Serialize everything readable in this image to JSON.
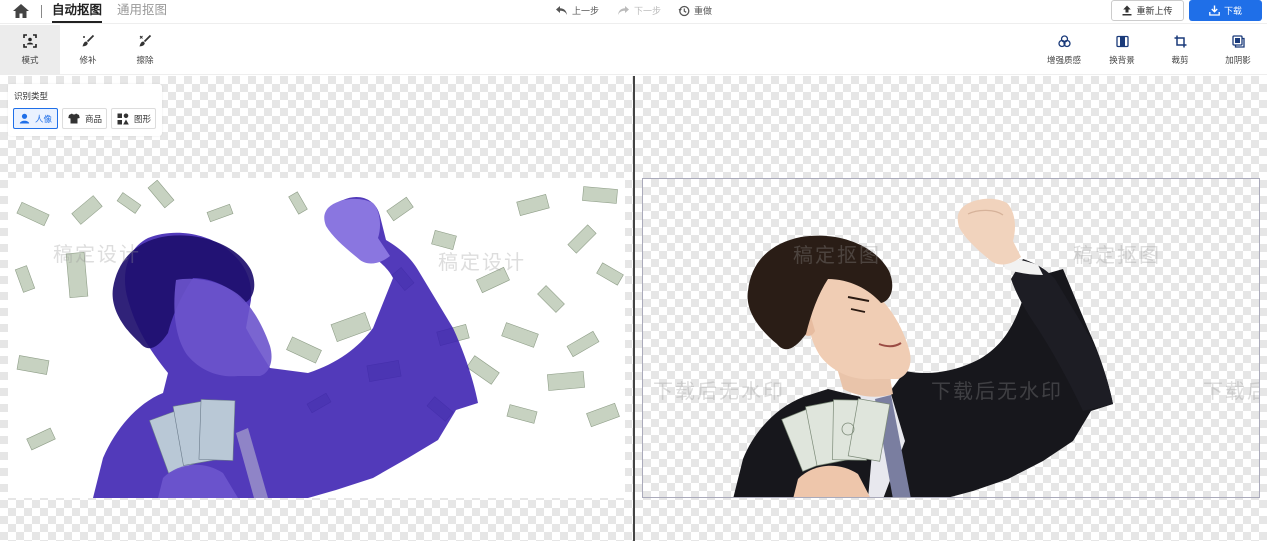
{
  "topbar": {
    "tabs": [
      {
        "label": "自动抠图",
        "active": true
      },
      {
        "label": "通用抠图",
        "active": false
      }
    ],
    "undo_label": "上一步",
    "redo_label": "下一步",
    "reset_label": "重做",
    "reupload_label": "重新上传",
    "download_label": "下载"
  },
  "toolbar": {
    "left_tools": [
      {
        "label": "模式",
        "icon": "mode-icon",
        "active": true
      },
      {
        "label": "修补",
        "icon": "brush-icon"
      },
      {
        "label": "擦除",
        "icon": "eraser-icon"
      }
    ],
    "right_tools": [
      {
        "label": "增强质感",
        "icon": "enhance-icon"
      },
      {
        "label": "换背景",
        "icon": "background-icon"
      },
      {
        "label": "裁剪",
        "icon": "crop-icon"
      },
      {
        "label": "加阴影",
        "icon": "shadow-icon"
      }
    ]
  },
  "recognition_panel": {
    "title": "识别类型",
    "options": [
      {
        "label": "人像",
        "icon": "person-icon",
        "selected": true
      },
      {
        "label": "商品",
        "icon": "shirt-icon",
        "selected": false
      },
      {
        "label": "图形",
        "icon": "shapes-icon",
        "selected": false
      }
    ]
  },
  "watermarks": {
    "left": [
      "稿定设计",
      "稿定设计"
    ],
    "right": [
      "稿定抠图",
      "稿定抠图",
      "下载后无水印",
      "下载后无水印",
      "下载后"
    ]
  },
  "colors": {
    "accent": "#1f6fe8",
    "mask_overlay": "#3a1fb0"
  }
}
